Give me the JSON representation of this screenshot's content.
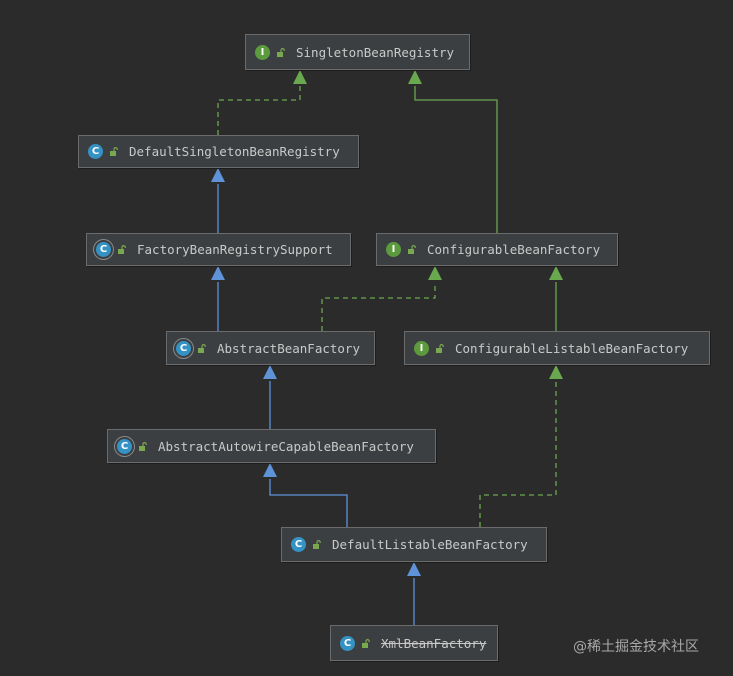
{
  "diagram": {
    "nodes": [
      {
        "id": "singleton-bean-registry",
        "kind": "I",
        "label": "SingletonBeanRegistry",
        "icon": "interface-icon"
      },
      {
        "id": "default-singleton-bean-registry",
        "kind": "C",
        "label": "DefaultSingletonBeanRegistry",
        "icon": "class-icon"
      },
      {
        "id": "factory-bean-registry-support",
        "kind": "C",
        "label": "FactoryBeanRegistrySupport",
        "icon": "abstract-class-icon"
      },
      {
        "id": "configurable-bean-factory",
        "kind": "I",
        "label": "ConfigurableBeanFactory",
        "icon": "interface-icon"
      },
      {
        "id": "abstract-bean-factory",
        "kind": "C",
        "label": "AbstractBeanFactory",
        "icon": "abstract-class-icon"
      },
      {
        "id": "configurable-listable-bean-factory",
        "kind": "I",
        "label": "ConfigurableListableBeanFactory",
        "icon": "interface-icon"
      },
      {
        "id": "abstract-autowire-capable-bean-factory",
        "kind": "C",
        "label": "AbstractAutowireCapableBeanFactory",
        "icon": "abstract-class-icon"
      },
      {
        "id": "default-listable-bean-factory",
        "kind": "C",
        "label": "DefaultListableBeanFactory",
        "icon": "class-icon"
      },
      {
        "id": "xml-bean-factory",
        "kind": "C",
        "label": "XmlBeanFactory",
        "icon": "class-icon",
        "deprecated": true
      }
    ],
    "edges": [
      {
        "from": "default-singleton-bean-registry",
        "to": "singleton-bean-registry",
        "type": "implements"
      },
      {
        "from": "factory-bean-registry-support",
        "to": "default-singleton-bean-registry",
        "type": "extends"
      },
      {
        "from": "configurable-bean-factory",
        "to": "singleton-bean-registry",
        "type": "interface-extends"
      },
      {
        "from": "abstract-bean-factory",
        "to": "factory-bean-registry-support",
        "type": "extends"
      },
      {
        "from": "abstract-bean-factory",
        "to": "configurable-bean-factory",
        "type": "implements"
      },
      {
        "from": "configurable-listable-bean-factory",
        "to": "configurable-bean-factory",
        "type": "interface-extends"
      },
      {
        "from": "abstract-autowire-capable-bean-factory",
        "to": "abstract-bean-factory",
        "type": "extends"
      },
      {
        "from": "default-listable-bean-factory",
        "to": "abstract-autowire-capable-bean-factory",
        "type": "extends"
      },
      {
        "from": "default-listable-bean-factory",
        "to": "configurable-listable-bean-factory",
        "type": "implements"
      },
      {
        "from": "xml-bean-factory",
        "to": "default-listable-bean-factory",
        "type": "extends"
      }
    ],
    "colors": {
      "extends": "#5e93d8",
      "implements": "#6aa84f",
      "interface-extends": "#6aa84f"
    },
    "watermark": "@稀土掘金技术社区"
  }
}
